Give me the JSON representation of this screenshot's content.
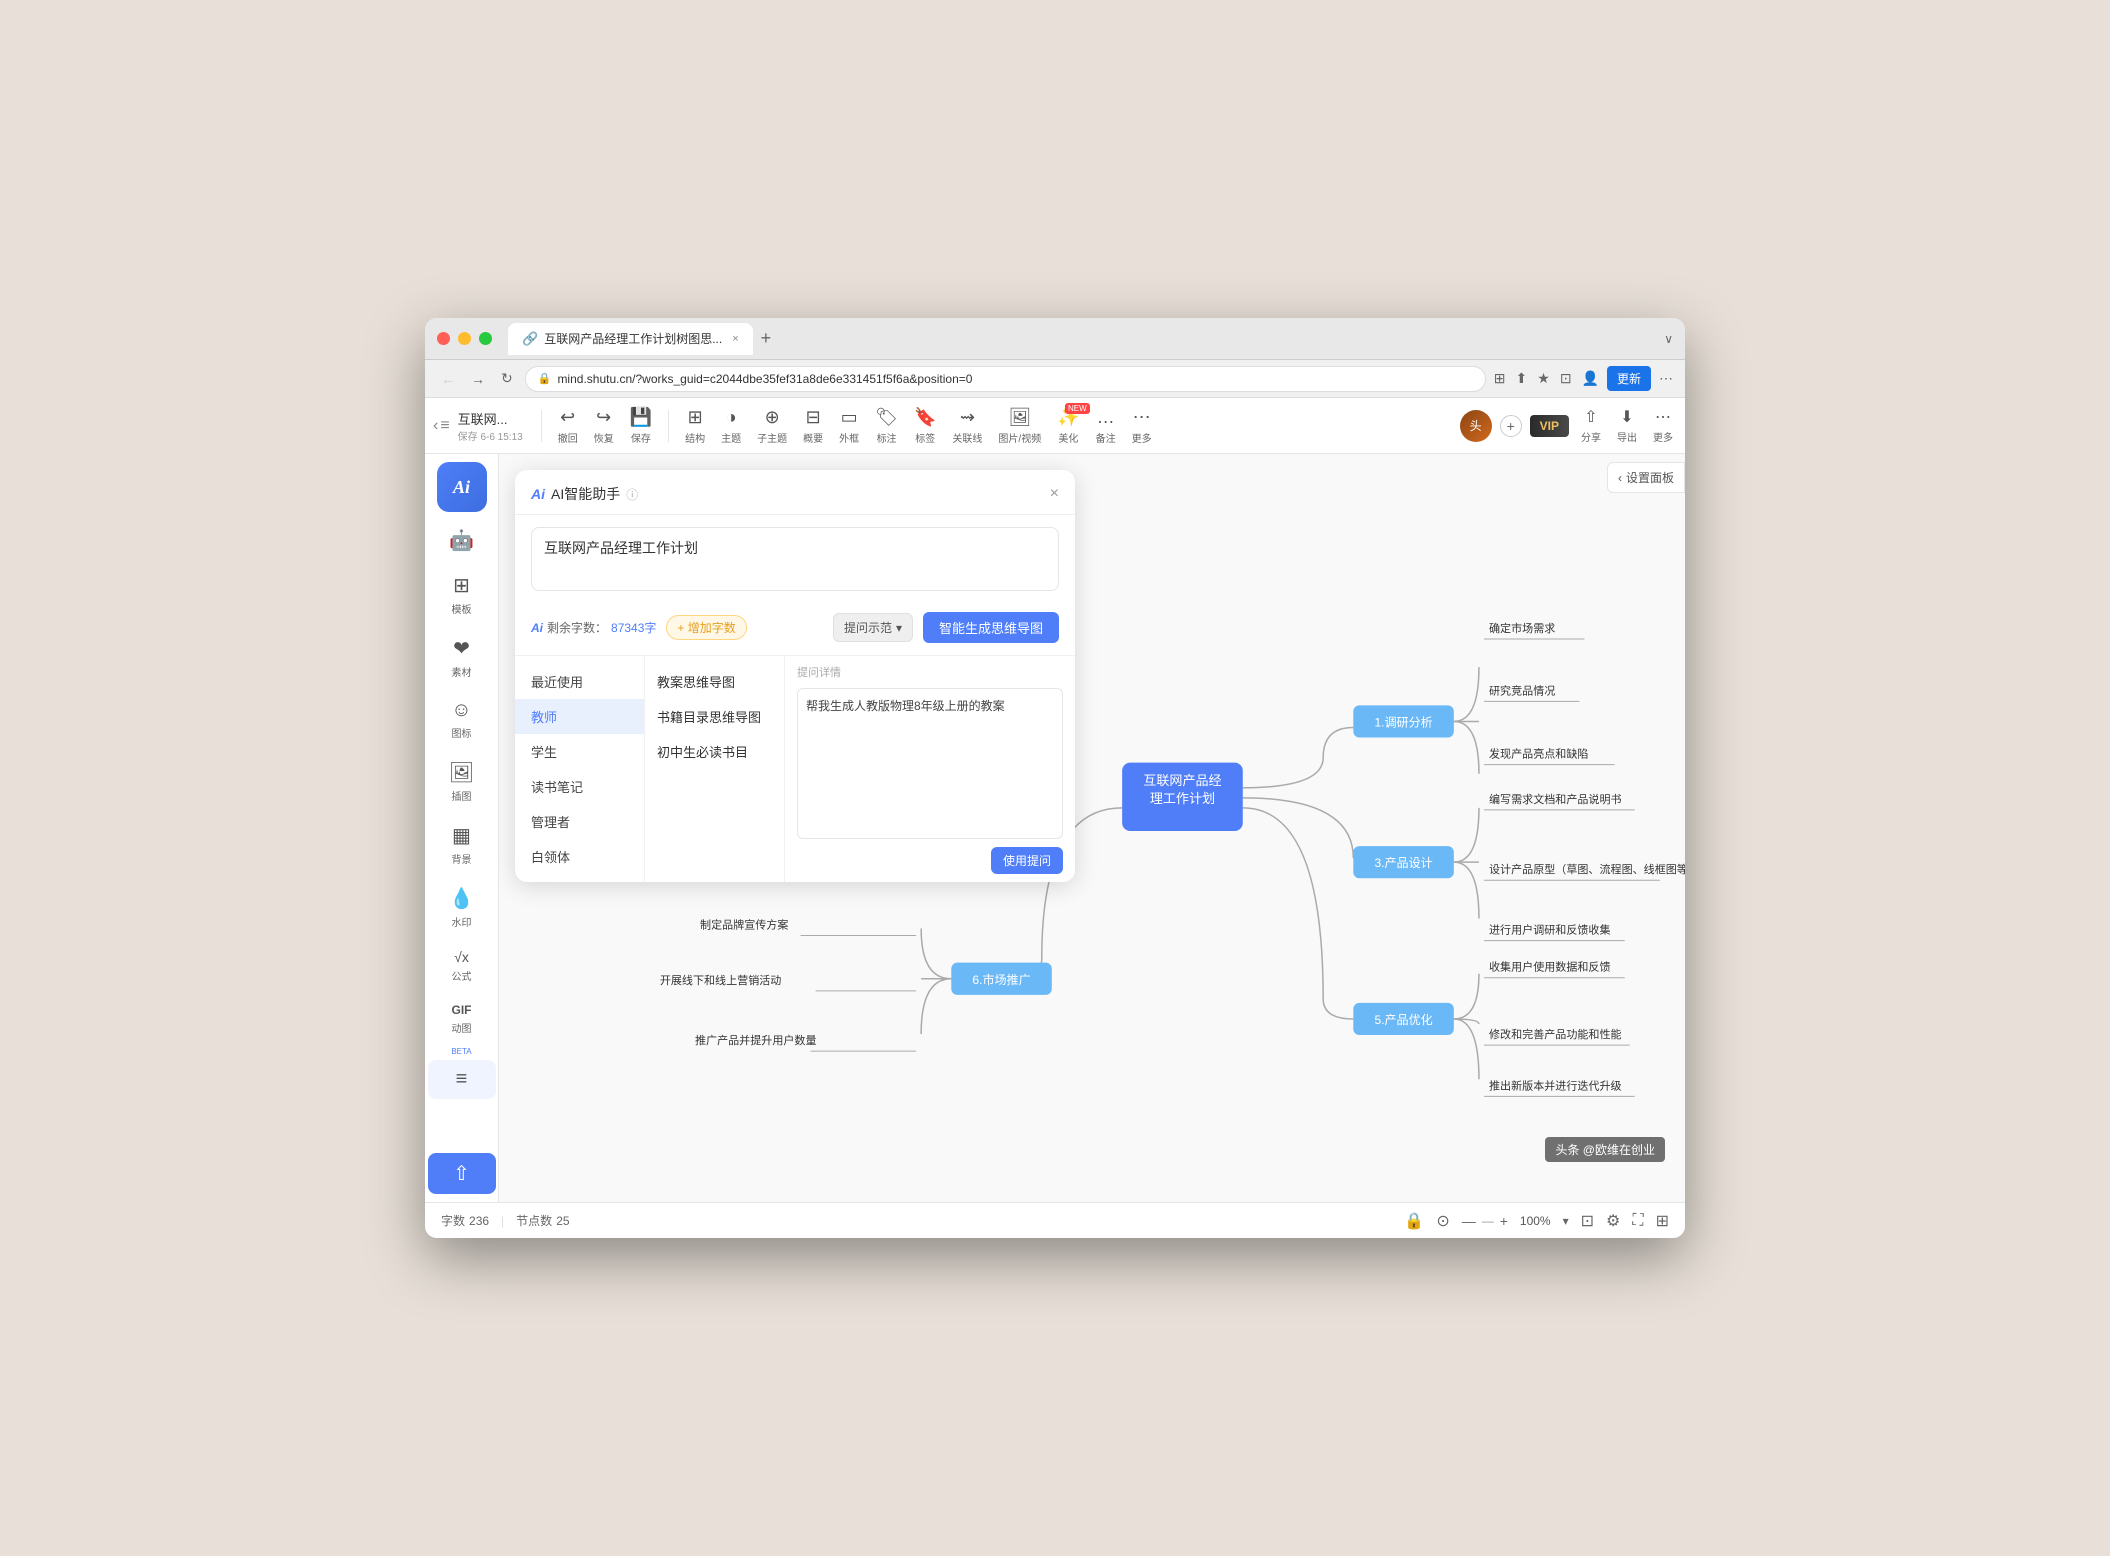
{
  "browser": {
    "tab_title": "互联网产品经理工作计划树图思...",
    "tab_icon": "🔗",
    "url": "mind.shutu.cn/?works_guid=c2044dbe35fef31a8de6e331451f5f6a&position=0",
    "update_label": "更新",
    "new_tab_label": "+"
  },
  "toolbar": {
    "app_name": "互联网...",
    "save_info": "保存 6-6 15:13",
    "undo_label": "撤回",
    "redo_label": "恢复",
    "save_label": "保存",
    "structure_label": "结构",
    "theme_label": "主题",
    "sub_theme_label": "子主题",
    "overview_label": "概要",
    "frame_label": "外框",
    "mark_label": "标注",
    "tag_label": "标签",
    "relation_label": "关联线",
    "media_label": "图片/视频",
    "beauty_label": "美化",
    "more_label": "备注",
    "more2_label": "更多",
    "share_label": "分享",
    "export_label": "导出",
    "more3_label": "更多",
    "vip_label": "VIP"
  },
  "sidebar": {
    "ai_text": "Ai",
    "items": [
      {
        "label": "模板",
        "icon": "⊞"
      },
      {
        "label": "素材",
        "icon": "❤"
      },
      {
        "label": "图标",
        "icon": "☺"
      },
      {
        "label": "插图",
        "icon": "🖼"
      },
      {
        "label": "背景",
        "icon": "▦"
      },
      {
        "label": "水印",
        "icon": "💧"
      },
      {
        "label": "公式",
        "icon": "√"
      },
      {
        "label": "GIF\n动图",
        "icon": "GIF"
      },
      {
        "label": "列表",
        "icon": "≡",
        "beta": "BETA"
      }
    ],
    "share_icon": "🔗"
  },
  "ai_panel": {
    "title": "AI智能助手",
    "logo_text": "Ai",
    "info_icon": "ⓘ",
    "close_icon": "×",
    "input_value": "互联网产品经理工作计划",
    "remaining_label": "剩余字数：",
    "remaining_count": "87343字",
    "add_btn_label": "+ 增加字数",
    "prompt_btn_label": "提问示范",
    "generate_btn_label": "智能生成思维导图",
    "categories": [
      {
        "label": "最近使用",
        "active": false
      },
      {
        "label": "教师",
        "active": true
      },
      {
        "label": "学生",
        "active": false
      },
      {
        "label": "读书笔记",
        "active": false
      },
      {
        "label": "管理者",
        "active": false
      },
      {
        "label": "白领体",
        "active": false
      }
    ],
    "templates": [
      {
        "label": "教案思维导图"
      },
      {
        "label": "书籍目录思维导图"
      },
      {
        "label": "初中生必读书目"
      }
    ],
    "detail_label": "提问详情",
    "detail_content": "帮我生成人教版物理8年级上册的教案",
    "use_btn_label": "使用提问"
  },
  "mindmap": {
    "center_node": "互联网产品经\n理工作计划",
    "branches": [
      {
        "label": "1.调研分析",
        "position": "right-top",
        "children": [
          "确定市场需求",
          "研究竞品情况",
          "发现产品亮点和缺陷"
        ]
      },
      {
        "label": "3.产品设计",
        "position": "right-mid",
        "children": [
          "编写需求文档和产品说明书",
          "设计产品原型（草图、流程图、线框图等）",
          "进行用户调研和反馈收集"
        ]
      },
      {
        "label": "5.产品优化",
        "position": "right-bot",
        "children": [
          "收集用户使用数据和反馈",
          "修改和完善产品功能和性能",
          "推出新版本并进行迭代升级"
        ]
      },
      {
        "label": "6.市场推广",
        "position": "left-bot",
        "children": [
          "制定品牌宣传方案",
          "开展线下和线上营销活动",
          "推广产品并提升用户数量"
        ]
      }
    ]
  },
  "status_bar": {
    "word_count_label": "字数",
    "word_count": "236",
    "node_count_label": "节点数",
    "node_count": "25",
    "zoom_minus": "—",
    "zoom_bar": "—",
    "zoom_plus": "+",
    "zoom_level": "100%",
    "zoom_dropdown": "▾"
  },
  "settings_panel": {
    "toggle_label": "设置面板",
    "toggle_icon": "‹"
  },
  "watermark": {
    "text": "头条 @欧维在创业"
  }
}
